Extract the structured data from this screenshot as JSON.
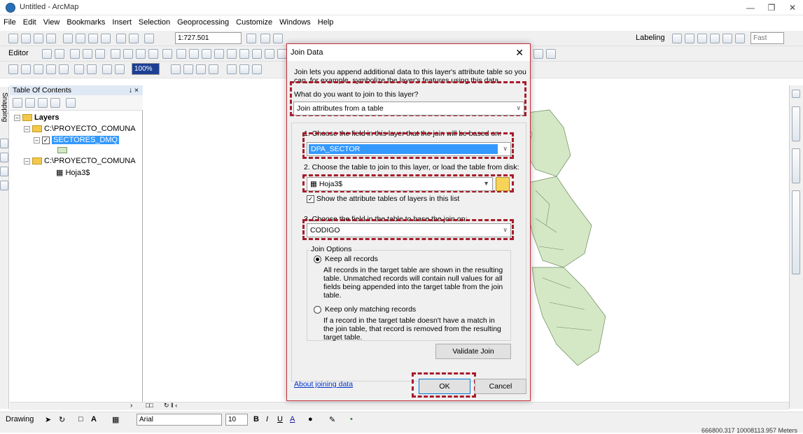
{
  "window": {
    "title": "Untitled - ArcMap"
  },
  "menu": [
    "File",
    "Edit",
    "View",
    "Bookmarks",
    "Insert",
    "Selection",
    "Geoprocessing",
    "Customize",
    "Windows",
    "Help"
  ],
  "toolbar": {
    "scale": "1:727.501",
    "labeling": "Labeling",
    "fast": "Fast",
    "editor": "Editor",
    "zoom": "100%"
  },
  "snapping_label": "Snapping",
  "toc": {
    "title": "Table Of Contents",
    "pin": "↓ ×",
    "layers_label": "Layers",
    "group1": "C:\\PROYECTO_COMUNA",
    "layer1": "SECTORES_DMQ",
    "group2": "C:\\PROYECTO_COMUNA",
    "table1": "Hoja3$"
  },
  "dialog": {
    "title": "Join Data",
    "intro": "Join lets you append additional data to this layer's attribute table so you can, for example, symbolize the layer's features using this data.",
    "question": "What do you want to join to this layer?",
    "join_type": "Join attributes from a table",
    "step1": "1.  Choose the field in this layer that the join will be based on:",
    "field1": "DPA_SECTOR",
    "step2": "2.  Choose the table to join to this layer, or load the table from disk:",
    "table": "Hoja3$",
    "show_tables": "Show the attribute tables of layers in this list",
    "step3": "3.  Choose the field in the table to base the join on:",
    "field2": "CODIGO",
    "options_label": "Join Options",
    "keep_all": "Keep all records",
    "keep_all_desc": "All records in the target table are shown in the resulting table. Unmatched records will contain null values for all fields being appended into the target table from the join table.",
    "keep_matching": "Keep only matching records",
    "keep_matching_desc": "If a record in the target table doesn't have a match in the join table, that record is removed from the resulting target table.",
    "validate": "Validate Join",
    "about": "About joining data",
    "ok": "OK",
    "cancel": "Cancel"
  },
  "drawing": {
    "label": "Drawing",
    "font": "Arial",
    "size": "10"
  },
  "status": {
    "coords": "666800.317  10008113.957 Meters"
  },
  "colors": {
    "highlight": "#a81c2a",
    "selection": "#3399ff",
    "polygon_fill": "#d4e8c6"
  }
}
